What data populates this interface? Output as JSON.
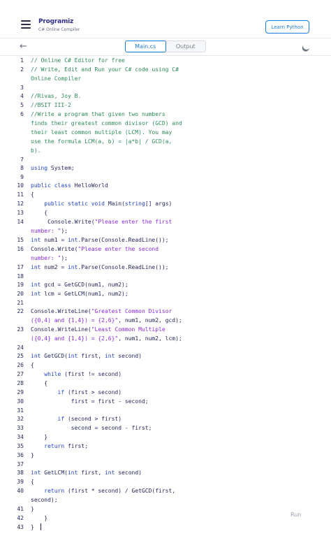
{
  "header": {
    "logo_text": "Programiz",
    "subtitle": "C# Online Compiler",
    "learn_button": "Learn Python",
    "icons": {
      "menu": "hamburger-menu-icon",
      "back": "arrow-left-icon",
      "theme": "moon-icon"
    }
  },
  "tabs": [
    {
      "label": "Main.cs",
      "active": true
    },
    {
      "label": "Output",
      "active": false
    }
  ],
  "editor": {
    "lines": [
      {
        "n": "1",
        "t": "// Online C# Editor for free",
        "h": 13
      },
      {
        "n": "2",
        "t": "// Write, Edit and Run your C# code using C# Online Compiler",
        "h": 26
      },
      {
        "n": "3",
        "t": "",
        "h": 12
      },
      {
        "n": "4",
        "t": "//Rivas, Joy B.",
        "h": 13
      },
      {
        "n": "5",
        "t": "//BSIT III-2",
        "h": 13
      },
      {
        "n": "6",
        "t": "//Write a program that given two numbers finds their greatest common divisor (GCD) and their least common multiple (LCM). You may use the formula LCM(a, b) = |a*b| / GCD(a, b).",
        "h": 65
      },
      {
        "n": "7",
        "t": "",
        "h": 12
      },
      {
        "n": "8",
        "t": "using System;",
        "h": 13
      },
      {
        "n": "9",
        "t": "",
        "h": 12
      },
      {
        "n": "10",
        "t": "public class HelloWorld",
        "h": 13
      },
      {
        "n": "11",
        "t": "{",
        "h": 13
      },
      {
        "n": "12",
        "t": "    public static void Main(string[] args)",
        "h": 13
      },
      {
        "n": "13",
        "t": "    {",
        "h": 13
      },
      {
        "n": "14",
        "t": "     Console.Write(\"Please enter the first number: \");",
        "h": 26
      },
      {
        "n": "15",
        "t": "int num1 = int.Parse(Console.ReadLine());",
        "h": 13
      },
      {
        "n": "16",
        "t": "Console.Write(\"Please enter the second number: \");",
        "h": 26
      },
      {
        "n": "17",
        "t": "int num2 = int.Parse(Console.ReadLine());",
        "h": 13
      },
      {
        "n": "18",
        "t": "",
        "h": 12
      },
      {
        "n": "19",
        "t": "int gcd = GetGCD(num1, num2);",
        "h": 13
      },
      {
        "n": "20",
        "t": "int lcm = GetLCM(num1, num2);",
        "h": 13
      },
      {
        "n": "21",
        "t": "",
        "h": 12
      },
      {
        "n": "22",
        "t": "Console.WriteLine(\"Greatest Common Divisor ({0,4) and {1,4}) = {2,6}\", num1, num2, gcd);",
        "h": 26
      },
      {
        "n": "23",
        "t": "Console.WriteLine(\"Least Common Multiple ({0,4} and {1,4}) = {2,6}\", num1, num2, lcm);",
        "h": 26
      },
      {
        "n": "24",
        "t": "",
        "h": 12
      },
      {
        "n": "25",
        "t": "int GetGCD(int first, int second)",
        "h": 13
      },
      {
        "n": "26",
        "t": "{",
        "h": 13
      },
      {
        "n": "27",
        "t": "    while (first != second)",
        "h": 13
      },
      {
        "n": "28",
        "t": "    {",
        "h": 13
      },
      {
        "n": "29",
        "t": "        if (first > second)",
        "h": 13
      },
      {
        "n": "30",
        "t": "            first = first - second;",
        "h": 13
      },
      {
        "n": "31",
        "t": "",
        "h": 12
      },
      {
        "n": "32",
        "t": "        if (second > first)",
        "h": 13
      },
      {
        "n": "33",
        "t": "            second = second - first;",
        "h": 13
      },
      {
        "n": "34",
        "t": "    }",
        "h": 13
      },
      {
        "n": "35",
        "t": "    return first;",
        "h": 13
      },
      {
        "n": "36",
        "t": "}",
        "h": 13
      },
      {
        "n": "37",
        "t": "",
        "h": 12
      },
      {
        "n": "38",
        "t": "int GetLCM(int first, int second)",
        "h": 13
      },
      {
        "n": "39",
        "t": "{",
        "h": 13
      },
      {
        "n": "40",
        "t": "    return (first * second) / GetGCD(first, second);",
        "h": 26
      },
      {
        "n": "41",
        "t": "}",
        "h": 13
      },
      {
        "n": "42",
        "t": "    }",
        "h": 13
      },
      {
        "n": "43",
        "t": "}",
        "h": 13
      }
    ]
  },
  "run_label": "Run",
  "colors": {
    "accent": "#1e7be0",
    "code_text": "#25265e",
    "keyword": "#2244cc",
    "comment": "#2e8b57",
    "string": "#8a2be2"
  }
}
